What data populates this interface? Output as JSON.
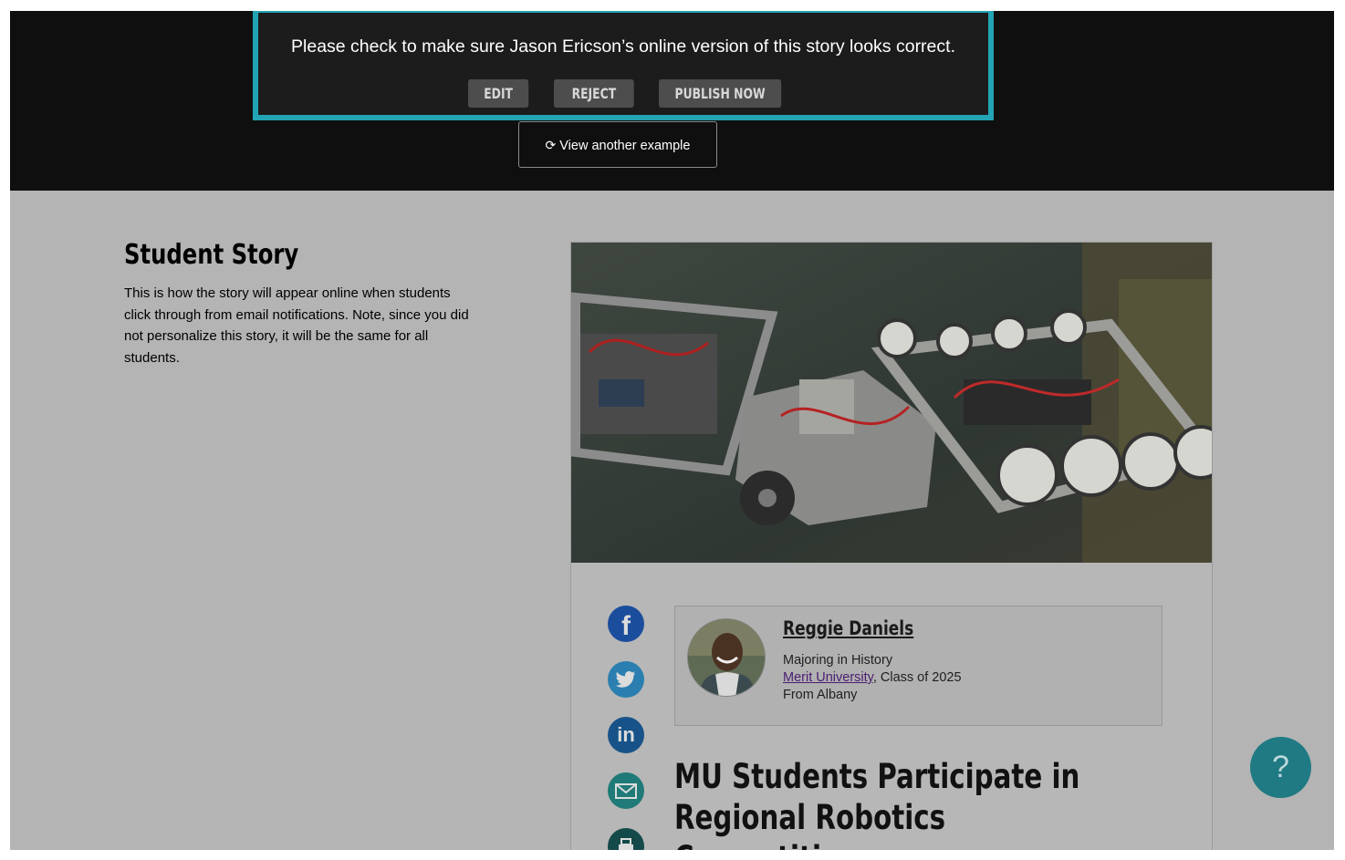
{
  "banner": {
    "message": "Please check to make sure Jason Ericson’s online version of this story looks correct.",
    "buttons": {
      "edit": "EDIT",
      "reject": "REJECT",
      "publish": "PUBLISH NOW"
    },
    "accent_color": "#22a4b4"
  },
  "view_another": {
    "icon": "refresh-icon",
    "label": "View another example"
  },
  "intro": {
    "heading": "Student Story",
    "description": "This is how the story will appear online when students click through from email notifications. Note, since you did not personalize this story, it will be the same for all students."
  },
  "story": {
    "social_icons": [
      "facebook-icon",
      "twitter-icon",
      "linkedin-icon",
      "email-icon",
      "print-icon"
    ],
    "profile": {
      "name": "Reggie Daniels",
      "major": "Majoring in History",
      "university": "Merit University",
      "class_of": ", Class of 2025",
      "hometown": "From Albany"
    },
    "title": "MU Students Participate in Regional Robotics Competition"
  },
  "help": {
    "label": "?"
  }
}
